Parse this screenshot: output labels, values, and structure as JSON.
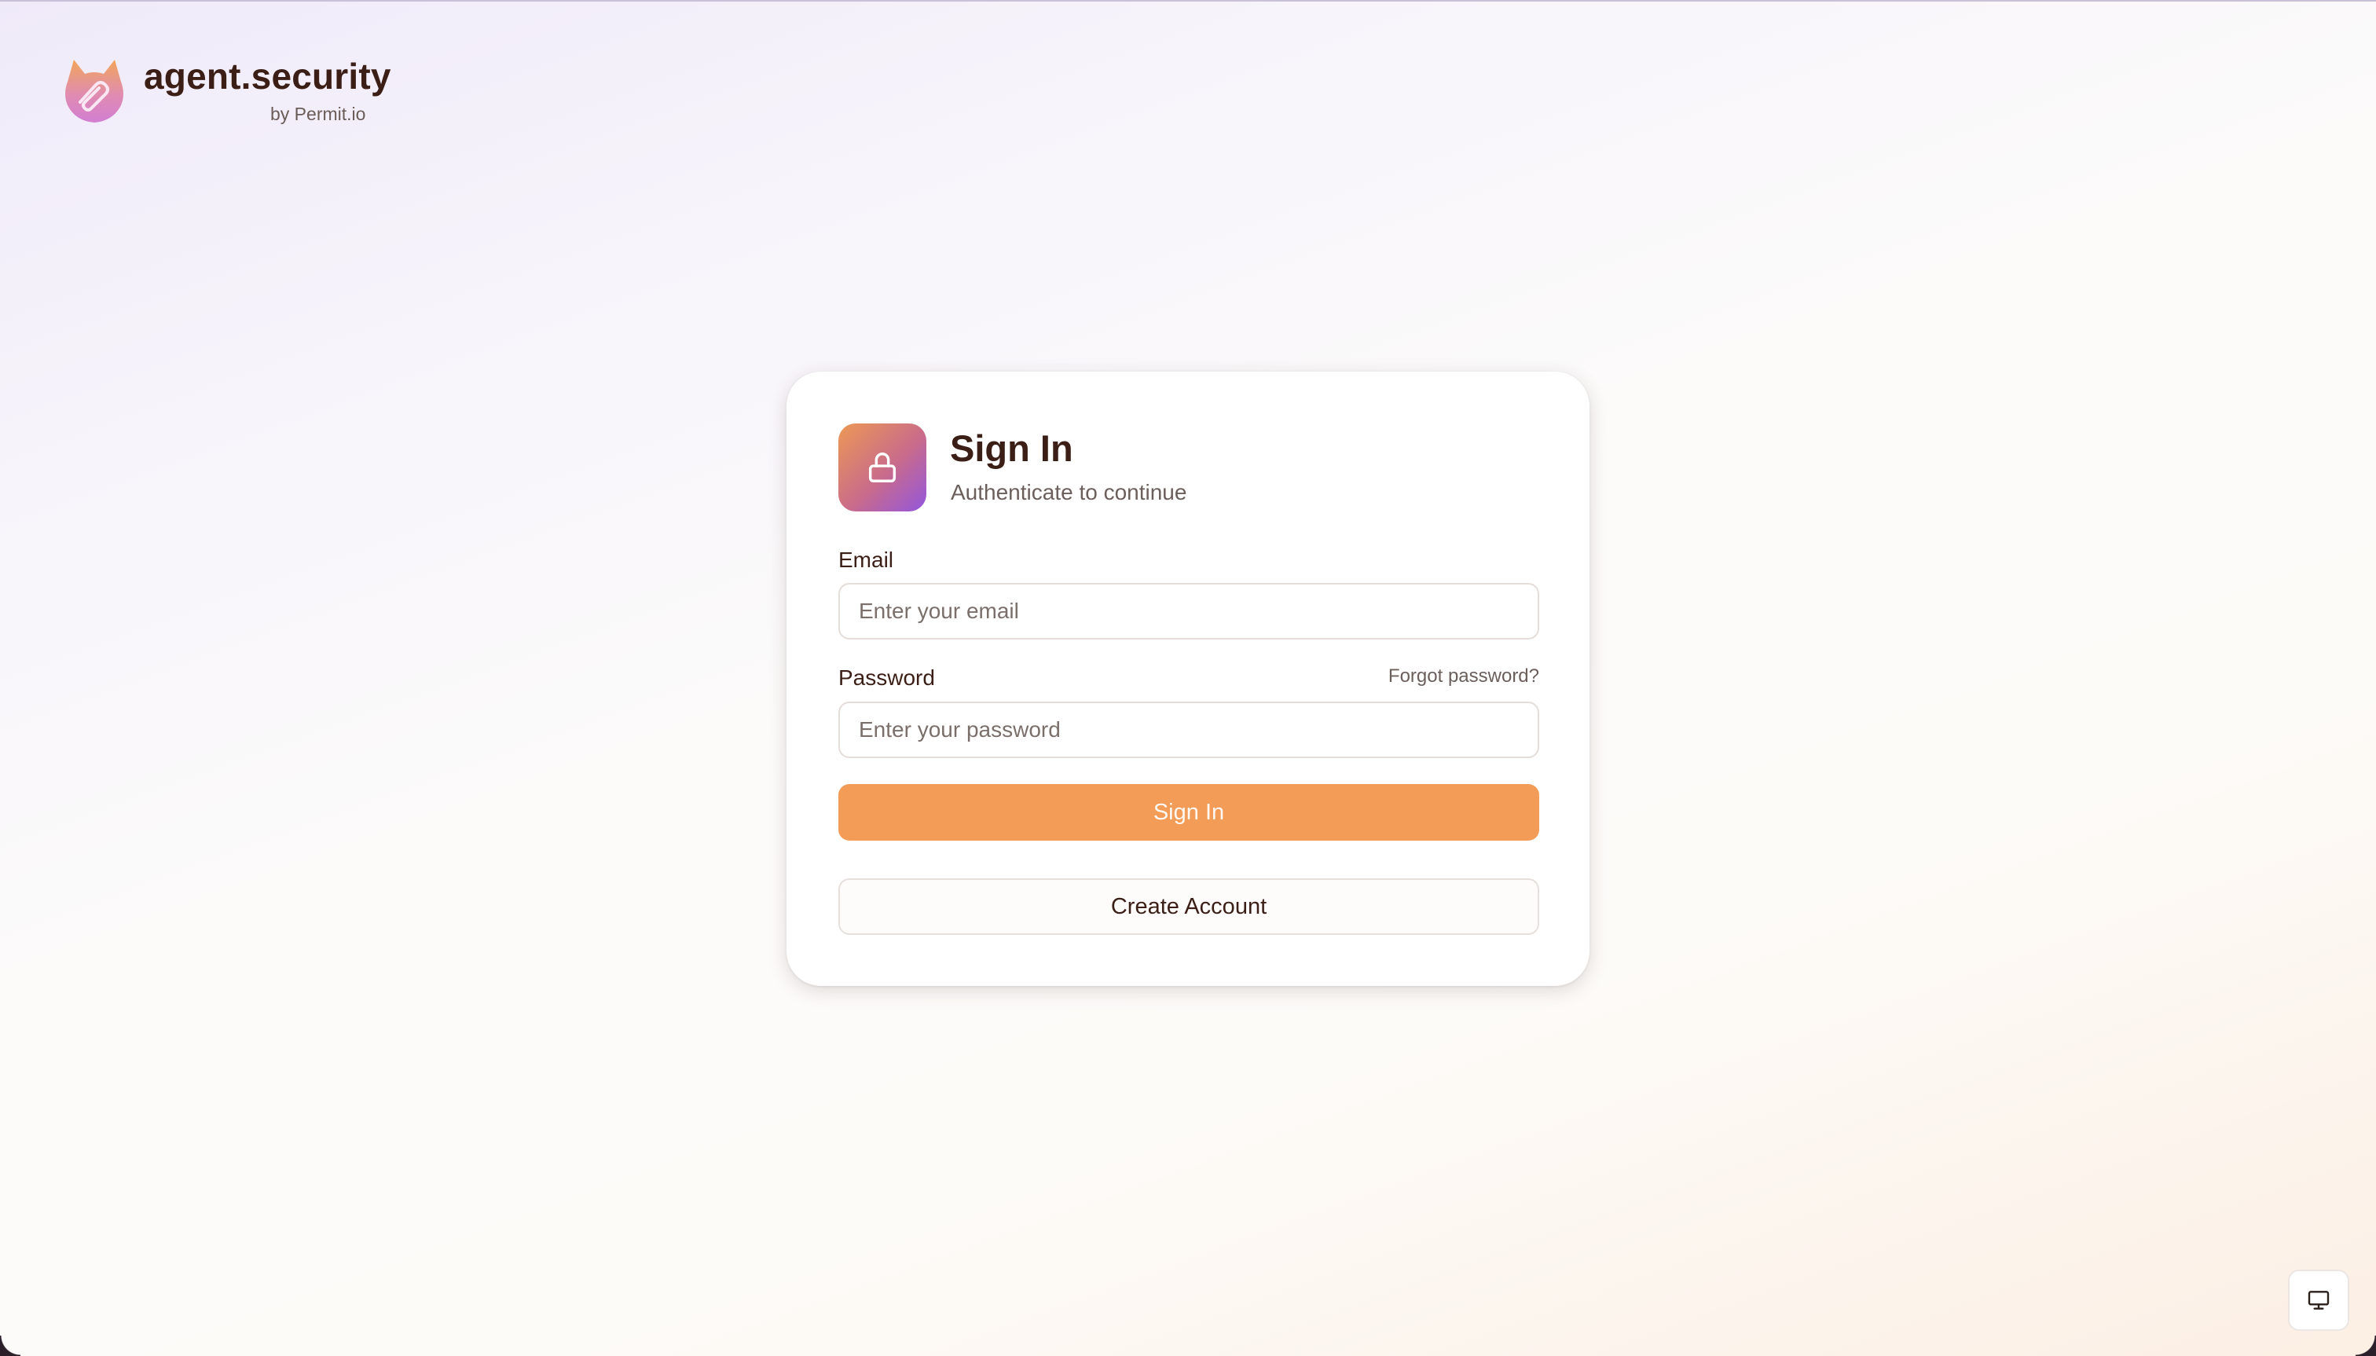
{
  "brand": {
    "name": "agent.security",
    "byline": "by Permit.io",
    "logo_icon": "agent-security-logo-icon"
  },
  "signin_card": {
    "icon": "lock-icon",
    "title": "Sign In",
    "subtitle": "Authenticate to continue",
    "email": {
      "label": "Email",
      "placeholder": "Enter your email",
      "value": ""
    },
    "password": {
      "label": "Password",
      "placeholder": "Enter your password",
      "value": "",
      "forgot_link": "Forgot password?"
    },
    "sign_in_button": "Sign In",
    "create_account_button": "Create Account"
  },
  "floating_button": {
    "icon": "monitor-icon"
  },
  "colors": {
    "primary_button": "#f29c58",
    "text_dark": "#3b1f17",
    "text_muted": "#6b5f5c",
    "lock_gradient_start": "#ec9955",
    "lock_gradient_end": "#9356de"
  }
}
